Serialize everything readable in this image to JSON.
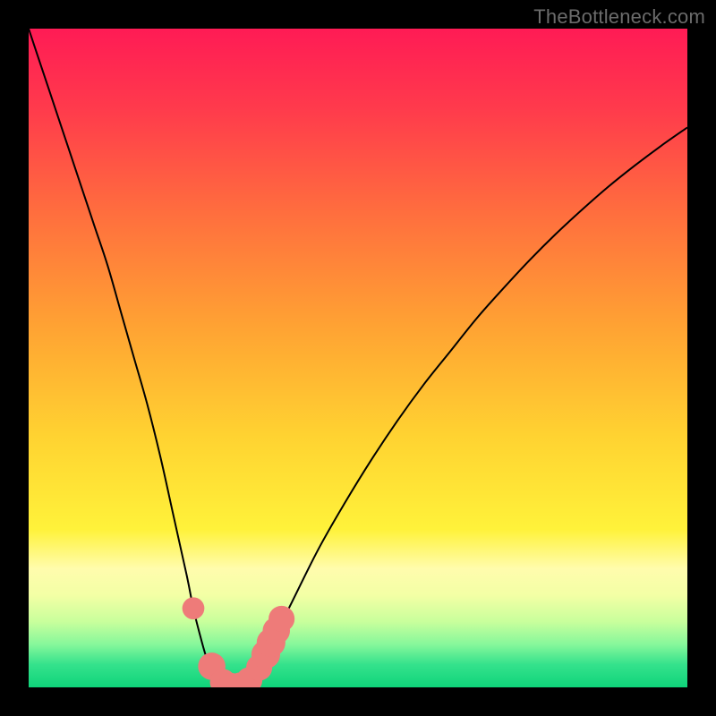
{
  "watermark": "TheBottleneck.com",
  "chart_data": {
    "type": "line",
    "title": "",
    "xlabel": "",
    "ylabel": "",
    "xlim": [
      0,
      100
    ],
    "ylim": [
      0,
      100
    ],
    "background_gradient": {
      "stops": [
        {
          "pos": 0.0,
          "color": "#ff1b55"
        },
        {
          "pos": 0.12,
          "color": "#ff3a4c"
        },
        {
          "pos": 0.28,
          "color": "#ff6e3e"
        },
        {
          "pos": 0.45,
          "color": "#ffa233"
        },
        {
          "pos": 0.62,
          "color": "#ffd331"
        },
        {
          "pos": 0.76,
          "color": "#fff23a"
        },
        {
          "pos": 0.82,
          "color": "#fffcad"
        },
        {
          "pos": 0.86,
          "color": "#f3ffa5"
        },
        {
          "pos": 0.9,
          "color": "#c9ff9c"
        },
        {
          "pos": 0.935,
          "color": "#86f79b"
        },
        {
          "pos": 0.965,
          "color": "#35e28c"
        },
        {
          "pos": 1.0,
          "color": "#0fd47a"
        }
      ]
    },
    "series": [
      {
        "name": "bottleneck-curve",
        "x": [
          0,
          2,
          4,
          6,
          8,
          10,
          12,
          14,
          16,
          18,
          20,
          22,
          24,
          25,
          26,
          27,
          28,
          29,
          30,
          31,
          32,
          33,
          34,
          35,
          37,
          40,
          44,
          48,
          52,
          56,
          60,
          64,
          68,
          72,
          76,
          80,
          84,
          88,
          92,
          96,
          100
        ],
        "y": [
          100,
          94,
          88,
          82,
          76,
          70,
          64,
          57,
          50,
          43,
          35,
          26,
          17,
          12,
          8,
          4.5,
          2.2,
          0.9,
          0.2,
          0,
          0,
          0.3,
          1.2,
          3,
          7,
          13,
          21,
          28,
          34.5,
          40.5,
          46,
          51,
          56,
          60.5,
          64.8,
          68.8,
          72.5,
          76,
          79.2,
          82.2,
          85
        ]
      }
    ],
    "markers": {
      "color": "#ee7b79",
      "points": [
        {
          "x": 25.0,
          "y": 12.0,
          "r": 1.0
        },
        {
          "x": 27.8,
          "y": 3.2,
          "r": 1.4
        },
        {
          "x": 29.5,
          "y": 0.8,
          "r": 1.3
        },
        {
          "x": 30.8,
          "y": 0.1,
          "r": 1.4
        },
        {
          "x": 32.2,
          "y": 0.2,
          "r": 1.4
        },
        {
          "x": 33.5,
          "y": 1.1,
          "r": 1.3
        },
        {
          "x": 35.0,
          "y": 3.0,
          "r": 1.3
        },
        {
          "x": 36.0,
          "y": 5.0,
          "r": 1.5
        },
        {
          "x": 36.8,
          "y": 6.8,
          "r": 1.5
        },
        {
          "x": 37.6,
          "y": 8.6,
          "r": 1.4
        },
        {
          "x": 38.4,
          "y": 10.4,
          "r": 1.3
        }
      ]
    }
  }
}
